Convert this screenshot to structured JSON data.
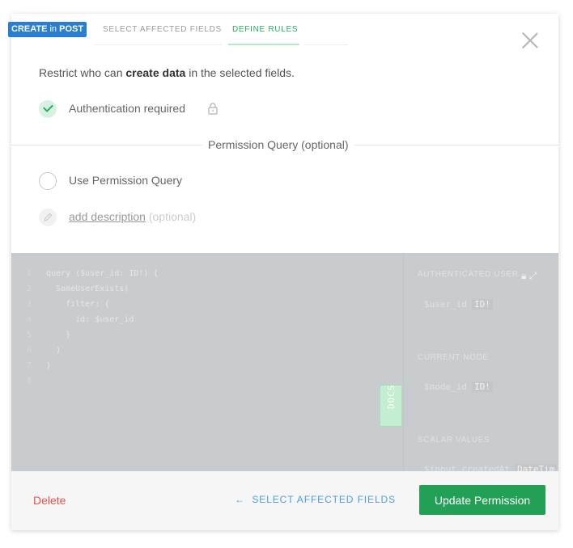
{
  "header": {
    "operation": "CREATE",
    "operation_in": "in",
    "type_name": "POST",
    "tabs": [
      {
        "label": "SELECT AFFECTED FIELDS",
        "active": false
      },
      {
        "label": "DEFINE RULES",
        "active": true
      }
    ]
  },
  "rules": {
    "intro_prefix": "Restrict who can",
    "intro_bold": "create data",
    "intro_suffix": "in the selected fields.",
    "auth_label": "Authentication required",
    "divider_label": "Permission Query (optional)",
    "use_query_label": "Use Permission Query",
    "add_description_link": "add description",
    "add_description_optional": "(optional)"
  },
  "editor": {
    "lines": [
      {
        "n": "1",
        "text": "query ($user_id: ID!) {"
      },
      {
        "n": "2",
        "text": "  SomeUserExists("
      },
      {
        "n": "3",
        "text": "    filter: {"
      },
      {
        "n": "4",
        "text": "      id: $user_id"
      },
      {
        "n": "5",
        "text": "    }"
      },
      {
        "n": "6",
        "text": "  )"
      },
      {
        "n": "7",
        "text": "}"
      },
      {
        "n": "8",
        "text": ""
      }
    ],
    "docs_label": "DOCS",
    "sidebar": {
      "authenticated_user": "AUTHENTICATED USER",
      "user_id_var": "$user_id",
      "user_id_type": "ID!",
      "current_node": "CURRENT NODE",
      "node_id_var": "$node_id",
      "node_id_type": "ID!",
      "scalar_values": "SCALAR VALUES",
      "scalar_var": "$input_createdAt",
      "scalar_type": "DateTim"
    }
  },
  "footer": {
    "delete_label": "Delete",
    "back_label": "SELECT AFFECTED FIELDS",
    "update_label": "Update Permission"
  },
  "colors": {
    "accent_green": "#21a056",
    "badge_blue": "#2a7ed2",
    "delete_red": "#e35353",
    "link_blue": "#4d9ee3"
  }
}
